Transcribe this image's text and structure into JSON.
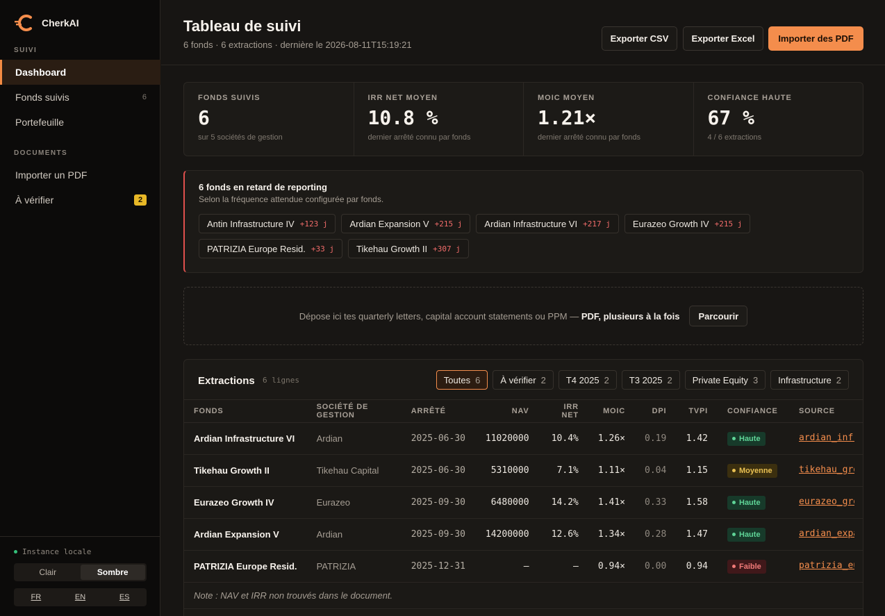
{
  "brand": {
    "name": "CherkAI",
    "accent": "#f48d4c"
  },
  "sidebar": {
    "section_suivi": "SUIVI",
    "section_documents": "DOCUMENTS",
    "items": [
      {
        "label": "Dashboard",
        "active": true
      },
      {
        "label": "Fonds suivis",
        "count": "6"
      },
      {
        "label": "Portefeuille"
      },
      {
        "label": "Importer un PDF"
      },
      {
        "label": "À vérifier",
        "badge": "2"
      }
    ],
    "instance": "Instance locale",
    "theme": {
      "light": "Clair",
      "dark": "Sombre",
      "selected": "Sombre"
    },
    "langs": [
      "FR",
      "EN",
      "ES"
    ]
  },
  "header": {
    "title": "Tableau de suivi",
    "subtitle": "6 fonds · 6 extractions · dernière le 2026-08-11T15:19:21",
    "export_csv": "Exporter CSV",
    "export_excel": "Exporter Excel",
    "import_pdf": "Importer des PDF"
  },
  "kpis": [
    {
      "label": "FONDS SUIVIS",
      "value": "6",
      "sub": "sur 5 sociétés de gestion"
    },
    {
      "label": "IRR NET MOYEN",
      "value": "10.8 %",
      "sub": "dernier arrêté connu par fonds"
    },
    {
      "label": "MOIC MOYEN",
      "value": "1.21×",
      "sub": "dernier arrêté connu par fonds"
    },
    {
      "label": "CONFIANCE HAUTE",
      "value": "67 %",
      "sub": "4 / 6 extractions"
    }
  ],
  "alert": {
    "title": "6 fonds en retard de reporting",
    "subtitle": "Selon la fréquence attendue configurée par fonds.",
    "chips": [
      {
        "name": "Antin Infrastructure IV",
        "delay": "+123 j"
      },
      {
        "name": "Ardian Expansion V",
        "delay": "+215 j"
      },
      {
        "name": "Ardian Infrastructure VI",
        "delay": "+217 j"
      },
      {
        "name": "Eurazeo Growth IV",
        "delay": "+215 j"
      },
      {
        "name": "PATRIZIA Europe Resid.",
        "delay": "+33 j"
      },
      {
        "name": "Tikehau Growth II",
        "delay": "+307 j"
      }
    ]
  },
  "dropzone": {
    "text": "Dépose ici tes quarterly letters, capital account statements ou PPM —",
    "bold": "PDF, plusieurs à la fois",
    "button": "Parcourir"
  },
  "extractions": {
    "title": "Extractions",
    "count": "6 lignes",
    "filters": [
      {
        "label": "Toutes",
        "n": "6",
        "selected": true
      },
      {
        "label": "À vérifier",
        "n": "2"
      },
      {
        "label": "T4 2025",
        "n": "2"
      },
      {
        "label": "T3 2025",
        "n": "2"
      },
      {
        "label": "Private Equity",
        "n": "3"
      },
      {
        "label": "Infrastructure",
        "n": "2"
      }
    ],
    "columns": [
      "FONDS",
      "SOCIÉTÉ DE GESTION",
      "ARRÊTÉ",
      "NAV",
      "IRR NET",
      "MOIC",
      "DPI",
      "TVPI",
      "CONFIANCE",
      "SOURCE"
    ],
    "rows": [
      {
        "fund": "Ardian Infrastructure VI",
        "soc": "Ardian",
        "date": "2025-06-30",
        "nav": "11020000",
        "irr": "10.4%",
        "moic": "1.26×",
        "dpi": "0.19",
        "tvpi": "1.42",
        "conf": "Haute",
        "level": "haute",
        "source": "ardian_infra_vi"
      },
      {
        "fund": "Tikehau Growth II",
        "soc": "Tikehau Capital",
        "date": "2025-06-30",
        "nav": "5310000",
        "irr": "7.1%",
        "moic": "1.11×",
        "dpi": "0.04",
        "tvpi": "1.15",
        "conf": "Moyenne",
        "level": "moy",
        "source": "tikehau_growth"
      },
      {
        "fund": "Eurazeo Growth IV",
        "soc": "Eurazeo",
        "date": "2025-09-30",
        "nav": "6480000",
        "irr": "14.2%",
        "moic": "1.41×",
        "dpi": "0.33",
        "tvpi": "1.58",
        "conf": "Haute",
        "level": "haute",
        "source": "eurazeo_growth"
      },
      {
        "fund": "Ardian Expansion V",
        "soc": "Ardian",
        "date": "2025-09-30",
        "nav": "14200000",
        "irr": "12.6%",
        "moic": "1.34×",
        "dpi": "0.28",
        "tvpi": "1.47",
        "conf": "Haute",
        "level": "haute",
        "source": "ardian_expansion"
      },
      {
        "fund": "PATRIZIA Europe Resid.",
        "soc": "PATRIZIA",
        "date": "2025-12-31",
        "nav": "—",
        "irr": "—",
        "moic": "0.94×",
        "dpi": "0.00",
        "tvpi": "0.94",
        "conf": "Faible",
        "level": "faible",
        "source": "patrizia_europe"
      }
    ],
    "note": "Note : NAV et IRR non trouvés dans le document."
  }
}
